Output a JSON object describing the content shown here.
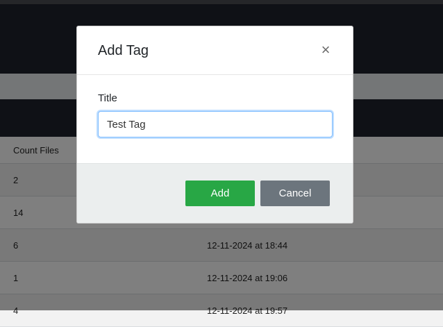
{
  "table": {
    "header": {
      "count_files": "Count Files"
    },
    "rows": [
      {
        "count": "2",
        "date": ""
      },
      {
        "count": "14",
        "date": ""
      },
      {
        "count": "6",
        "date": "12-11-2024 at 18:44"
      },
      {
        "count": "1",
        "date": "12-11-2024 at 19:06"
      },
      {
        "count": "4",
        "date": "12-11-2024 at 19:57"
      }
    ]
  },
  "modal": {
    "title": "Add Tag",
    "close_symbol": "×",
    "field_label": "Title",
    "input_value": "Test Tag",
    "add_label": "Add",
    "cancel_label": "Cancel"
  },
  "colors": {
    "accent": "#28a745",
    "secondary": "#6c757d",
    "dark_header": "#1f232c"
  }
}
